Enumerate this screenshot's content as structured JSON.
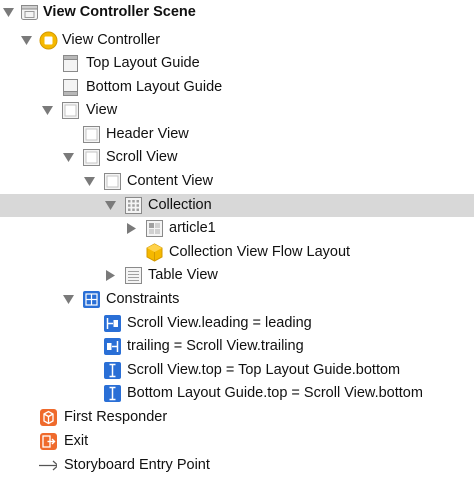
{
  "outline": {
    "scene_label": "View Controller Scene",
    "view_controller_label": "View Controller",
    "top_layout_guide_label": "Top Layout Guide",
    "bottom_layout_guide_label": "Bottom Layout Guide",
    "view_label": "View",
    "header_view_label": "Header View",
    "scroll_view_label": "Scroll View",
    "content_view_label": "Content View",
    "collection_label": "Collection",
    "article1_label": "article1",
    "flow_layout_label": "Collection View Flow Layout",
    "table_view_label": "Table View",
    "constraints_label": "Constraints",
    "constraint_1_label": "Scroll View.leading = leading",
    "constraint_2_label": "trailing = Scroll View.trailing",
    "constraint_3_label": "Scroll View.top = Top Layout Guide.bottom",
    "constraint_4_label": "Bottom Layout Guide.top = Scroll View.bottom",
    "first_responder_label": "First Responder",
    "exit_label": "Exit",
    "entry_point_label": "Storyboard Entry Point"
  },
  "colors": {
    "selection": "#d8d8d8",
    "constraint_blue": "#2a6fd6",
    "controller_yellow": "#f5b800",
    "responder_orange": "#ef6a2c",
    "disclosure_gray": "#7a7a7a"
  }
}
